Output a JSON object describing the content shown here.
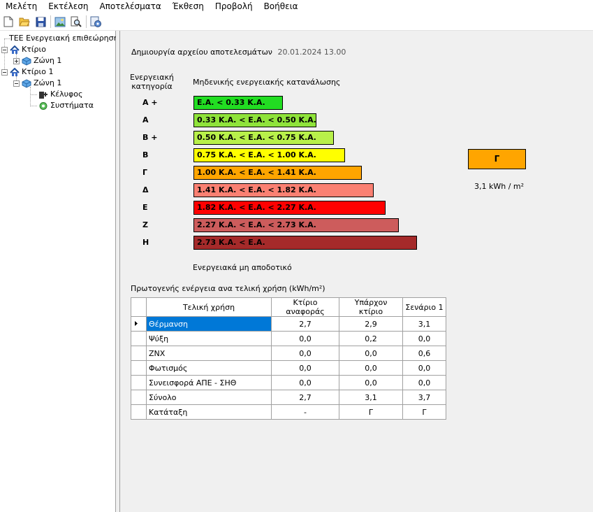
{
  "menu": [
    "Μελέτη",
    "Εκτέλεση",
    "Αποτελέσματα",
    "Έκθεση",
    "Προβολή",
    "Βοήθεια"
  ],
  "toolbar": {
    "icons": [
      "new-file-icon",
      "open-folder-icon",
      "save-icon",
      "image-icon",
      "print-preview-icon",
      "settings-report-icon"
    ]
  },
  "tree": {
    "root": "ΤΕΕ Ενεργειακή επιθεώρηση",
    "building_a": "Κτίριο",
    "zone_a": "Ζώνη 1",
    "building_b": "Κτίριο 1",
    "zone_b": "Ζώνη 1",
    "envelope": "Κέλυφος",
    "systems": "Συστήματα"
  },
  "header": {
    "label": "Δημιουργία αρχείου αποτελεσμάτων",
    "timestamp": "20.01.2024 13.00"
  },
  "rating": {
    "category_heading_1": "Ενεργειακή",
    "category_heading_2": "κατηγορία",
    "top_label": "Μηδενικής ενεργειακής κατανάλωσης",
    "bottom_label": "Ενεργειακά μη αποδοτικό",
    "result_class": "Γ",
    "result_value": "3,1 kWh / m²",
    "result_color": "#ffa500",
    "classes": [
      {
        "name": "Α +",
        "range": "Ε.Α. < 0.33 Κ.Α.",
        "color": "#22dd22"
      },
      {
        "name": "Α",
        "range": "0.33 Κ.Α. <  Ε.Α. < 0.50 Κ.Α.",
        "color": "#8fe33a"
      },
      {
        "name": "Β +",
        "range": "0.50 Κ.Α. <  Ε.Α. < 0.75 Κ.Α.",
        "color": "#b8f04a"
      },
      {
        "name": "Β",
        "range": "0.75 Κ.Α. <  Ε.Α. < 1.00 Κ.Α.",
        "color": "#ffff00"
      },
      {
        "name": "Γ",
        "range": "1.00 Κ.Α. <  Ε.Α. < 1.41 Κ.Α.",
        "color": "#ffa500"
      },
      {
        "name": "Δ",
        "range": "1.41 Κ.Α. <  Ε.Α. < 1.82 Κ.Α.",
        "color": "#fa8072"
      },
      {
        "name": "Ε",
        "range": "1.82 Κ.Α. <  Ε.Α. < 2.27 Κ.Α.",
        "color": "#ff0000"
      },
      {
        "name": "Ζ",
        "range": "2.27 Κ.Α. <  Ε.Α. < 2.73 Κ.Α.",
        "color": "#cd5c5c"
      },
      {
        "name": "Η",
        "range": "2.73 Κ.Α. <  Ε.Α.",
        "color": "#a52a2a"
      }
    ]
  },
  "table": {
    "title": "Πρωτογενής ενέργεια ανα τελική χρήση (kWh/m²)",
    "columns": [
      "Τελική χρήση",
      "Κτίριο αναφοράς",
      "Υπάρχον κτίριο",
      "Σενάριο 1"
    ],
    "rows": [
      [
        "Θέρμανση",
        "2,7",
        "2,9",
        "3,1"
      ],
      [
        "Ψύξη",
        "0,0",
        "0,2",
        "0,0"
      ],
      [
        "ΖΝΧ",
        "0,0",
        "0,0",
        "0,6"
      ],
      [
        "Φωτισμός",
        "0,0",
        "0,0",
        "0,0"
      ],
      [
        "Συνεισφορά ΑΠΕ - ΣΗΘ",
        "0,0",
        "0,0",
        "0,0"
      ],
      [
        "Σύνολο",
        "2,7",
        "3,1",
        "3,7"
      ],
      [
        "Κατάταξη",
        "-",
        "Γ",
        "Γ"
      ]
    ]
  }
}
